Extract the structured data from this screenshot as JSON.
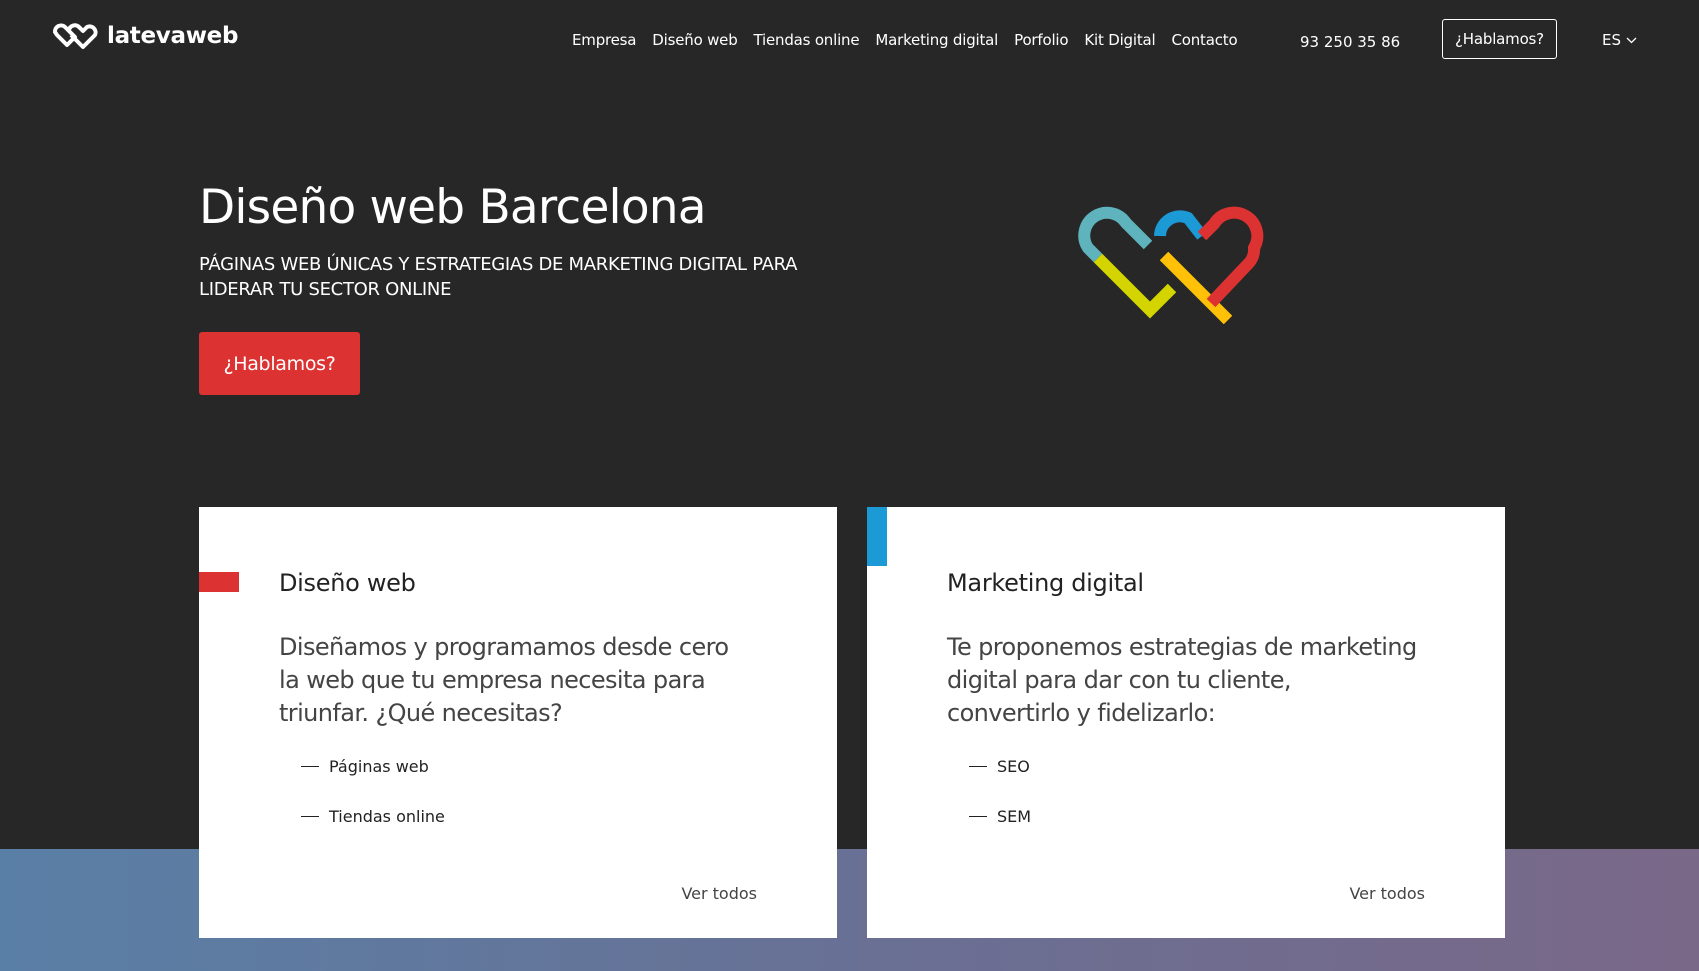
{
  "brand": {
    "name": "latevaweb",
    "colors": {
      "background": "#272727",
      "primary_red": "#dc3232",
      "blue": "#1b9ad6",
      "teal": "#5fb3bd",
      "yellow": "#d4d400",
      "orange": "#ffc107"
    }
  },
  "header": {
    "logo_icon": "heart-logo-icon",
    "nav": [
      {
        "label": "Empresa"
      },
      {
        "label": "Diseño web"
      },
      {
        "label": "Tiendas online"
      },
      {
        "label": "Marketing digital"
      },
      {
        "label": "Porfolio"
      },
      {
        "label": "Kit Digital"
      },
      {
        "label": "Contacto"
      }
    ],
    "phone": "93 250 35 86",
    "cta_label": "¿Hablamos?",
    "language": "ES",
    "language_icon": "chevron-down-icon"
  },
  "hero": {
    "title": "Diseño web Barcelona",
    "subtitle": "PÁGINAS WEB ÚNICAS Y ESTRATEGIAS DE MARKETING DIGITAL PARA LIDERAR TU SECTOR ONLINE",
    "cta_label": "¿Hablamos?"
  },
  "cards": [
    {
      "title": "Diseño web",
      "text": "Diseñamos y programamos desde cero la web que tu empresa necesita para triunfar. ¿Qué necesitas?",
      "items": [
        "Páginas web",
        "Tiendas online"
      ],
      "more_label": "Ver todos",
      "accent_color": "#dc3232"
    },
    {
      "title": "Marketing digital",
      "text": "Te proponemos estrategias de marketing digital para dar con tu cliente, convertirlo y fidelizarlo:",
      "items": [
        "SEO",
        "SEM"
      ],
      "more_label": "Ver todos",
      "accent_color": "#1b9ad6"
    }
  ]
}
